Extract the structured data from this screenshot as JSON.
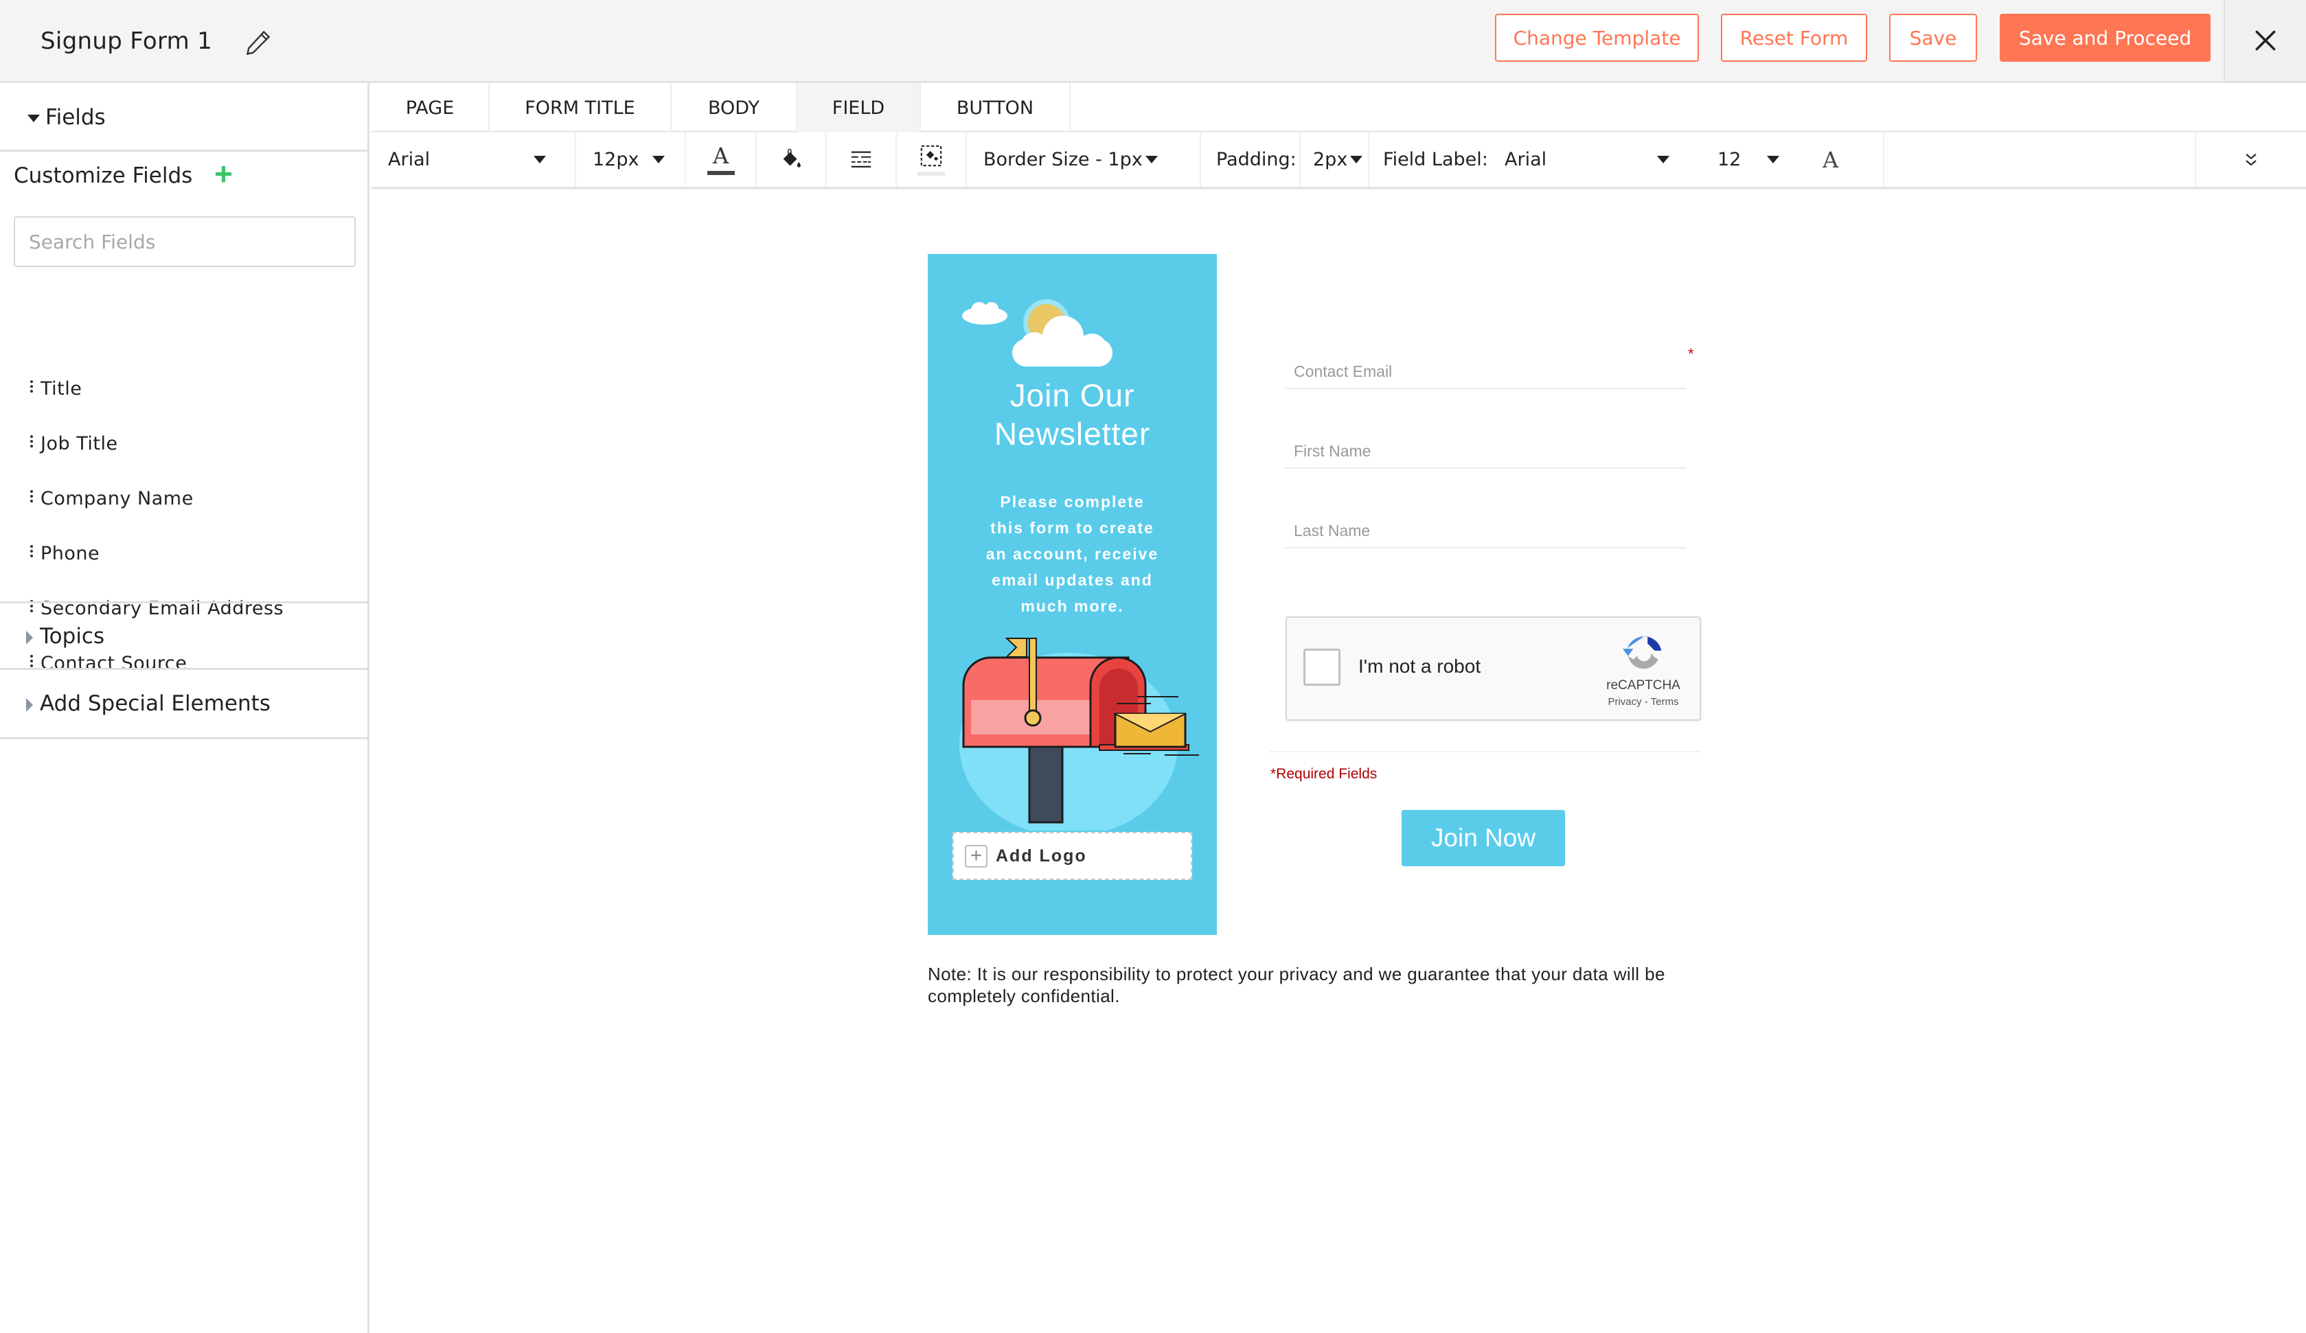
{
  "header": {
    "form_title": "Signup Form 1",
    "buttons": {
      "change_template": "Change Template",
      "reset_form": "Reset Form",
      "save": "Save",
      "save_and_proceed": "Save and Proceed"
    },
    "icons": {
      "edit": "pencil-icon",
      "close": "close-icon"
    }
  },
  "sidebar": {
    "fields_section": "Fields",
    "customize_fields": "Customize Fields",
    "search_placeholder": "Search Fields",
    "field_items": [
      "Title",
      "Job Title",
      "Company Name",
      "Phone",
      "Secondary Email Address",
      "Contact Source"
    ],
    "topics_section": "Topics",
    "special_elements_section": "Add Special Elements"
  },
  "tabs": [
    {
      "label": "PAGE",
      "active": false
    },
    {
      "label": "FORM TITLE",
      "active": false
    },
    {
      "label": "BODY",
      "active": false
    },
    {
      "label": "FIELD",
      "active": true
    },
    {
      "label": "BUTTON",
      "active": false
    }
  ],
  "toolbar": {
    "font_family": "Arial",
    "font_size": "12px",
    "icons": [
      "text-color-icon",
      "fill-color-icon",
      "border-style-icon",
      "border-color-icon",
      "expand-icon"
    ],
    "border_size": "Border Size - 1px",
    "padding_label": "Padding:",
    "padding_value": "2px",
    "field_label_label": "Field Label:",
    "field_label_font": "Arial",
    "field_label_size": "12"
  },
  "form": {
    "banner": {
      "title": "Join Our Newsletter",
      "description": "Please complete this form to create an account, receive email updates and much more.",
      "add_logo": "Add Logo",
      "background_color": "#5accea"
    },
    "fields": [
      {
        "placeholder": "Contact Email",
        "required": true,
        "value": ""
      },
      {
        "placeholder": "First Name",
        "required": false,
        "value": ""
      },
      {
        "placeholder": "Last Name",
        "required": false,
        "value": ""
      }
    ],
    "required_marker": "*",
    "captcha": {
      "label": "I'm not a robot",
      "brand": "reCAPTCHA",
      "links": "Privacy - Terms",
      "checked": false
    },
    "required_note": "*Required Fields",
    "submit_label": "Join Now",
    "privacy_note": "Note: It is our responsibility to protect your privacy and we guarantee that your data will be completely confidential."
  },
  "colors": {
    "accent": "#ff7654",
    "form_primary": "#5accea",
    "required_red": "#b00000",
    "add_green": "#3cc46a"
  }
}
